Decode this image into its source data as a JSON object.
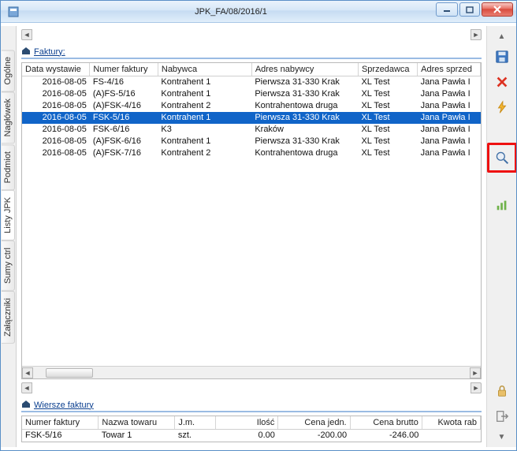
{
  "window": {
    "title": "JPK_FA/08/2016/1"
  },
  "vtabs": [
    "Ogólne",
    "Nagłówek",
    "Podmiot",
    "Listy JPK",
    "Sumy ctrl",
    "Załączniki"
  ],
  "faktury": {
    "label": "Faktury:",
    "cols": [
      "Data wystawie",
      "Numer faktury",
      "Nabywca",
      "Adres nabywcy",
      "Sprzedawca",
      "Adres sprzed"
    ],
    "rows": [
      {
        "d": "2016-08-05",
        "n": "FS-4/16",
        "nab": "Kontrahent 1",
        "adr": "Pierwsza 31-330 Krak",
        "spr": "XL Test",
        "adrs": "Jana Pawła I"
      },
      {
        "d": "2016-08-05",
        "n": "(A)FS-5/16",
        "nab": "Kontrahent 1",
        "adr": "Pierwsza 31-330 Krak",
        "spr": "XL Test",
        "adrs": "Jana Pawła I"
      },
      {
        "d": "2016-08-05",
        "n": "(A)FSK-4/16",
        "nab": "Kontrahent 2",
        "adr": "Kontrahentowa druga",
        "spr": "XL Test",
        "adrs": "Jana Pawła I"
      },
      {
        "d": "2016-08-05",
        "n": "FSK-5/16",
        "nab": "Kontrahent 1",
        "adr": "Pierwsza 31-330 Krak",
        "spr": "XL Test",
        "adrs": "Jana Pawła I",
        "sel": true
      },
      {
        "d": "2016-08-05",
        "n": "FSK-6/16",
        "nab": "K3",
        "adr": "Kraków",
        "spr": "XL Test",
        "adrs": "Jana Pawła I"
      },
      {
        "d": "2016-08-05",
        "n": "(A)FSK-6/16",
        "nab": "Kontrahent 1",
        "adr": "Pierwsza 31-330 Krak",
        "spr": "XL Test",
        "adrs": "Jana Pawła I"
      },
      {
        "d": "2016-08-05",
        "n": "(A)FSK-7/16",
        "nab": "Kontrahent 2",
        "adr": "Kontrahentowa druga",
        "spr": "XL Test",
        "adrs": "Jana Pawła I"
      }
    ]
  },
  "wiersze": {
    "label": "Wiersze faktury",
    "cols": [
      "Numer faktury",
      "Nazwa towaru",
      "J.m.",
      "Ilość",
      "Cena jedn.",
      "Cena brutto",
      "Kwota rab"
    ],
    "rows": [
      {
        "nf": "FSK-5/16",
        "nt": "Towar 1",
        "jm": "szt.",
        "il": "0.00",
        "cj": "-200.00",
        "cb": "-246.00",
        "kr": ""
      }
    ]
  },
  "icons": {
    "save": "save-icon",
    "delete": "delete-icon",
    "thunder": "lightning-icon",
    "search": "magnifier-icon",
    "chart": "chart-icon",
    "lock": "lock-icon",
    "exit": "exit-icon"
  }
}
